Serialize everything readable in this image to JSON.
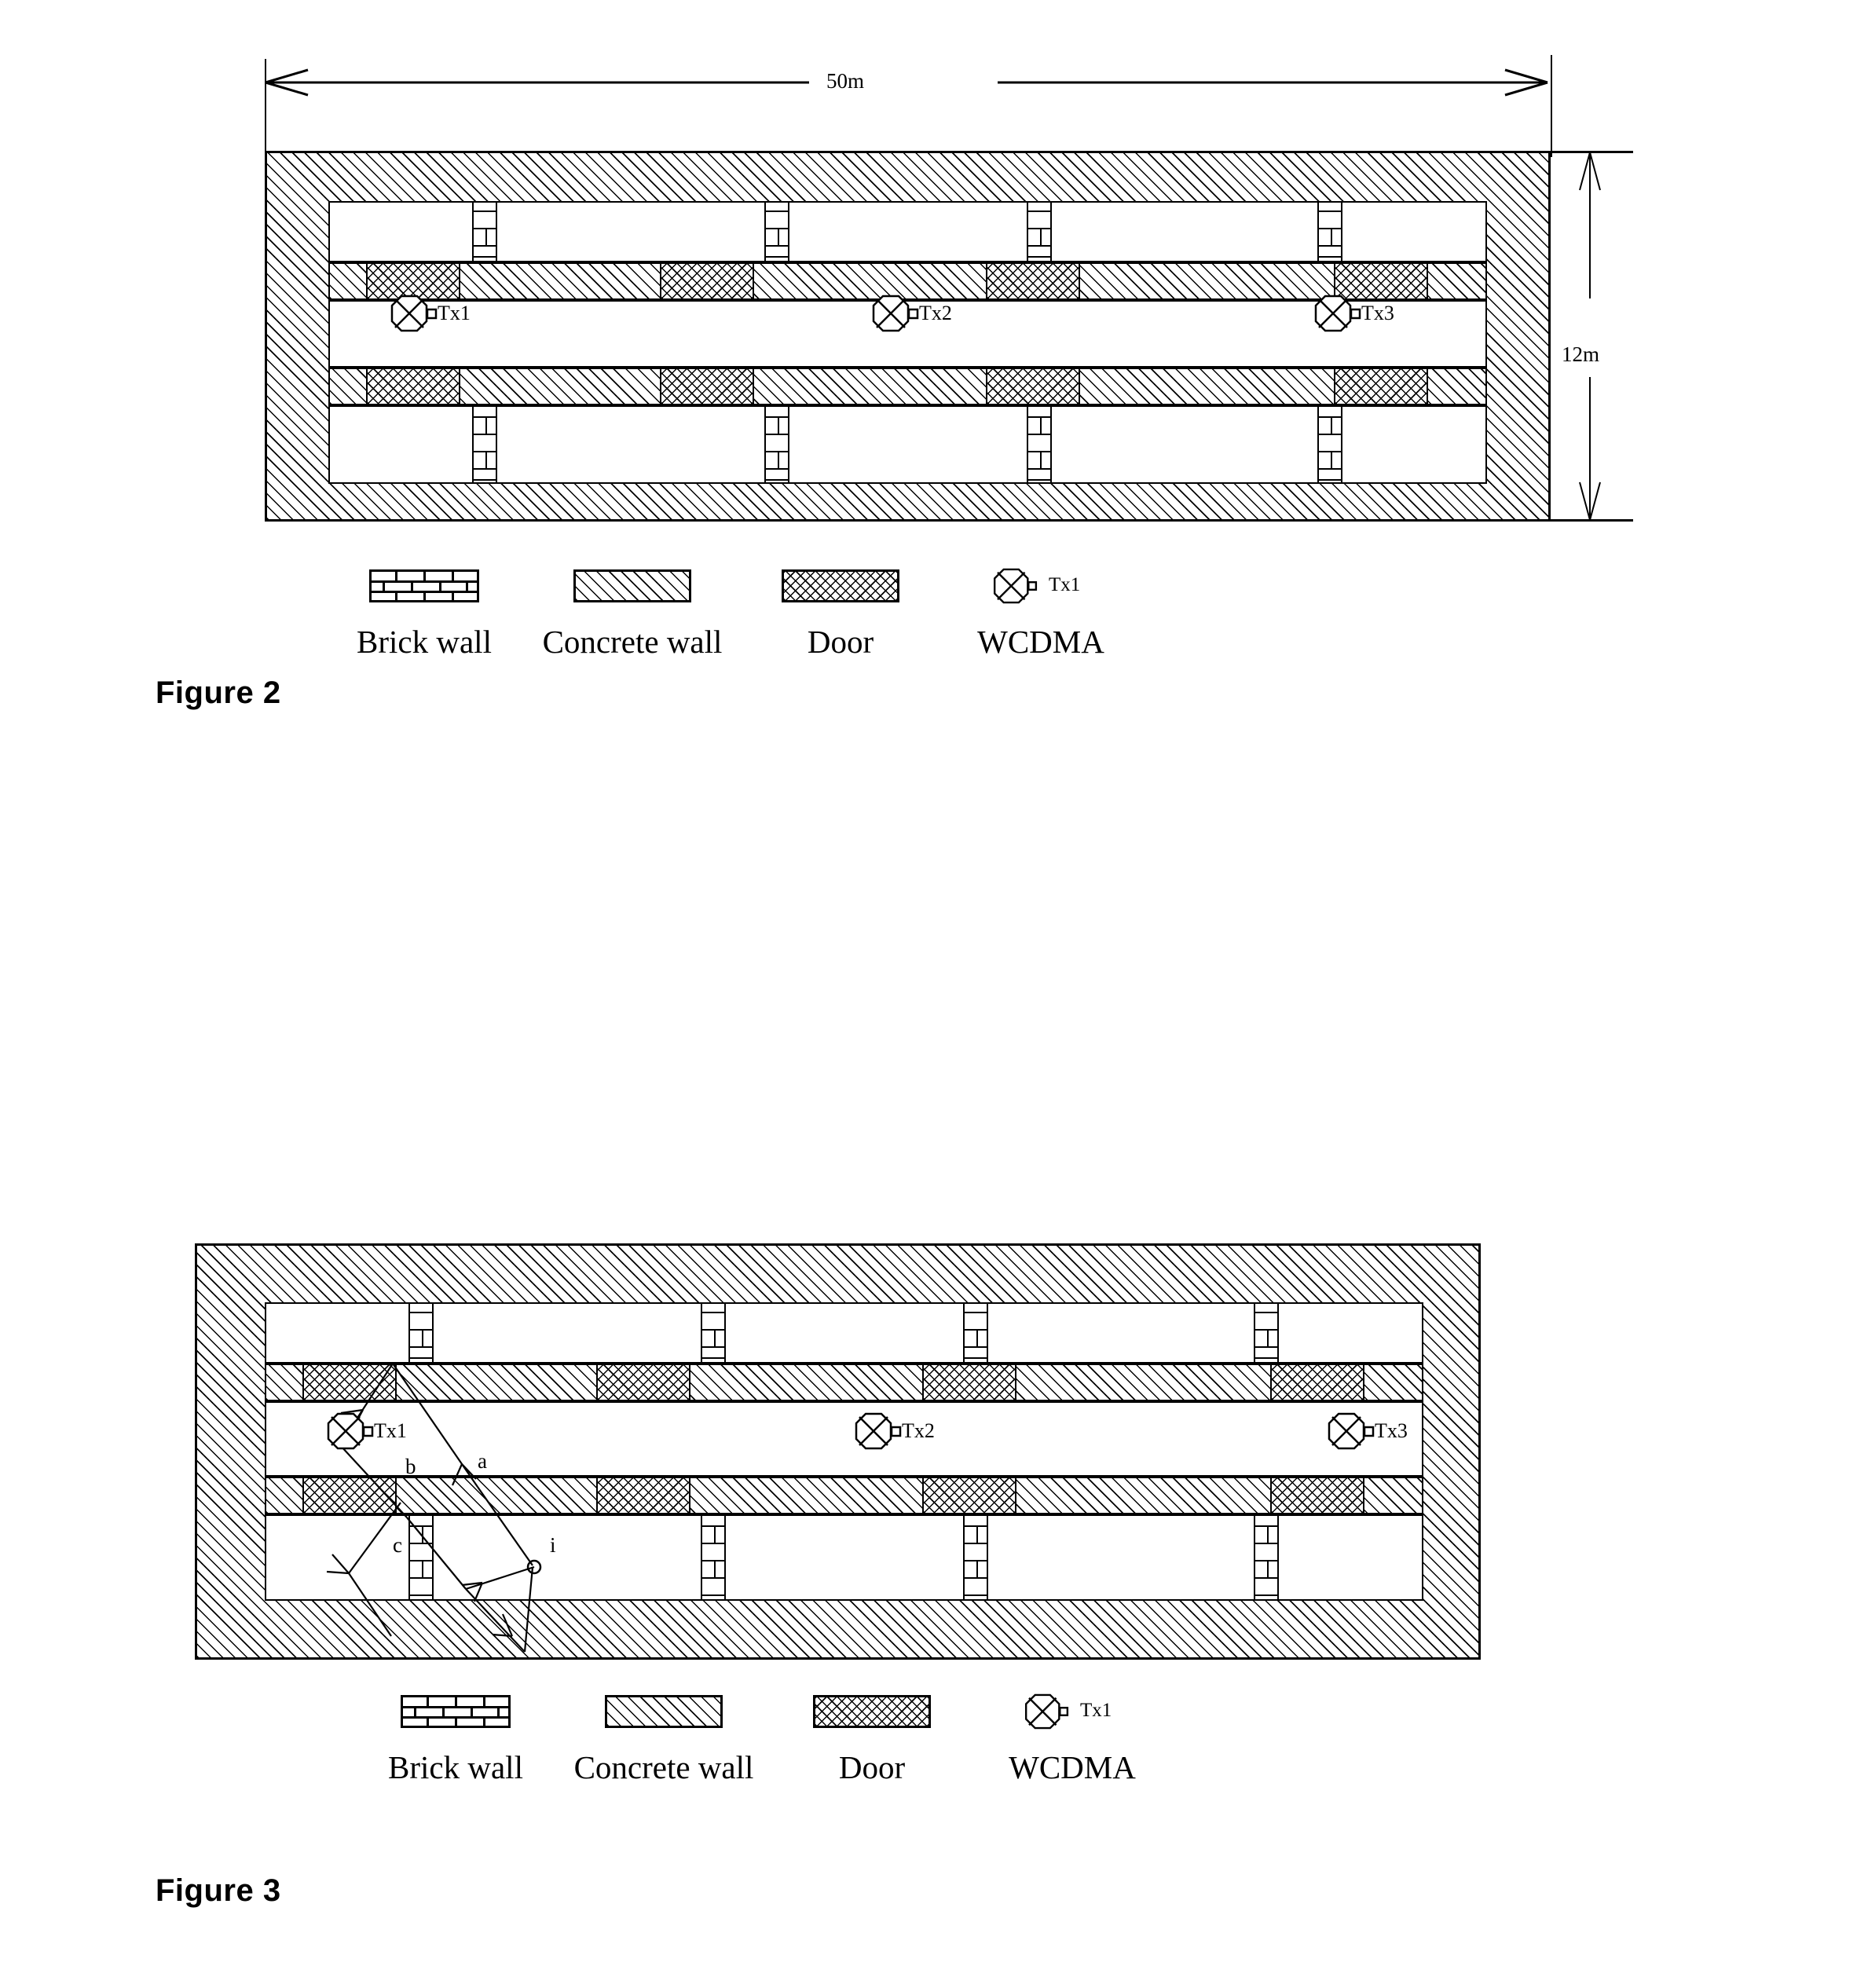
{
  "document": {
    "type": "patent-figure-sheet",
    "figures": [
      {
        "caption": "Figure 2",
        "description": "Building floor plan with three WCDMA transmitters",
        "dimensions": {
          "width_label": "50m",
          "height_label": "12m"
        },
        "transmitters": [
          {
            "id": "tx1",
            "label": "Tx1"
          },
          {
            "id": "tx2",
            "label": "Tx2"
          },
          {
            "id": "tx3",
            "label": "Tx3"
          }
        ],
        "legend": [
          {
            "key": "brick",
            "label": "Brick wall",
            "pattern": "brick"
          },
          {
            "key": "concrete",
            "label": "Concrete wall",
            "pattern": "diagonal-hatch"
          },
          {
            "key": "door",
            "label": "Door",
            "pattern": "cross-hatch"
          },
          {
            "key": "wcdma",
            "label": "WCDMA",
            "pattern": "octagon-antenna",
            "symbol_label": "Tx1"
          }
        ]
      },
      {
        "caption": "Figure 3",
        "description": "Same floor plan with ray-tracing propagation paths from Tx1 to receiver i",
        "transmitters": [
          {
            "id": "tx1",
            "label": "Tx1"
          },
          {
            "id": "tx2",
            "label": "Tx2"
          },
          {
            "id": "tx3",
            "label": "Tx3"
          }
        ],
        "ray_labels": [
          {
            "id": "a",
            "label": "a"
          },
          {
            "id": "b",
            "label": "b"
          },
          {
            "id": "c",
            "label": "c"
          },
          {
            "id": "i",
            "label": "i"
          }
        ],
        "legend": [
          {
            "key": "brick",
            "label": "Brick wall",
            "pattern": "brick"
          },
          {
            "key": "concrete",
            "label": "Concrete wall",
            "pattern": "diagonal-hatch"
          },
          {
            "key": "door",
            "label": "Door",
            "pattern": "cross-hatch"
          },
          {
            "key": "wcdma",
            "label": "WCDMA",
            "pattern": "octagon-antenna",
            "symbol_label": "Tx1"
          }
        ]
      }
    ],
    "colors": {
      "ink": "#000000",
      "paper": "#ffffff"
    }
  }
}
